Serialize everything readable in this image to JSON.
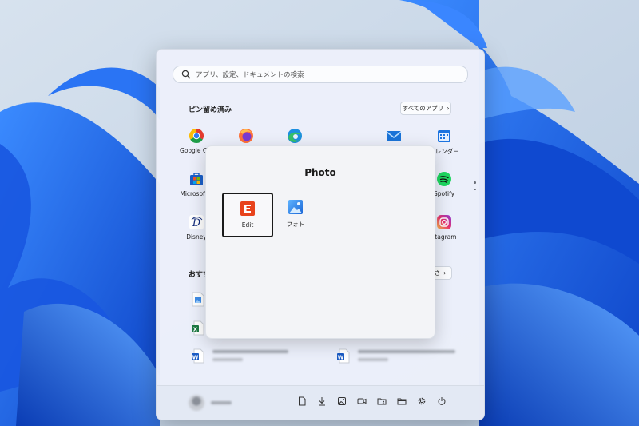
{
  "start_menu": {
    "search_placeholder": "アプリ、設定、ドキュメントの検索",
    "pinned_title": "ピン留め済み",
    "all_apps_label": "すべてのアプリ",
    "recommended_title": "おすす",
    "more_label": "さ",
    "pinned_apps": [
      {
        "label": "Google Chr",
        "icon": "chrome-icon"
      },
      {
        "label": "",
        "icon": "firefox-icon"
      },
      {
        "label": "",
        "icon": "edge-icon"
      },
      {
        "label": "",
        "icon": "mail-icon"
      },
      {
        "label": "カレンダー",
        "icon": "calendar-icon"
      },
      {
        "label": "Microsoft S",
        "icon": "store-icon"
      },
      {
        "label": "Spotify",
        "icon": "spotify-icon"
      },
      {
        "label": "Disney",
        "icon": "disney-icon"
      },
      {
        "label": "stagram",
        "icon": "instagram-icon"
      }
    ]
  },
  "folder": {
    "title": "Photo",
    "apps": [
      {
        "label": "Edit",
        "icon": "edit-app-icon",
        "selected": true
      },
      {
        "label": "フォト",
        "icon": "photos-icon",
        "selected": false
      }
    ]
  },
  "colors": {
    "accent": "#0a5fd6",
    "wallpaper": "#1f6ff0",
    "edit_icon": "#e8431c"
  },
  "bottom_icons": [
    "document-icon",
    "download-icon",
    "picture-icon",
    "video-icon",
    "user-folder-icon",
    "folder-icon",
    "settings-gear-icon",
    "power-icon"
  ]
}
